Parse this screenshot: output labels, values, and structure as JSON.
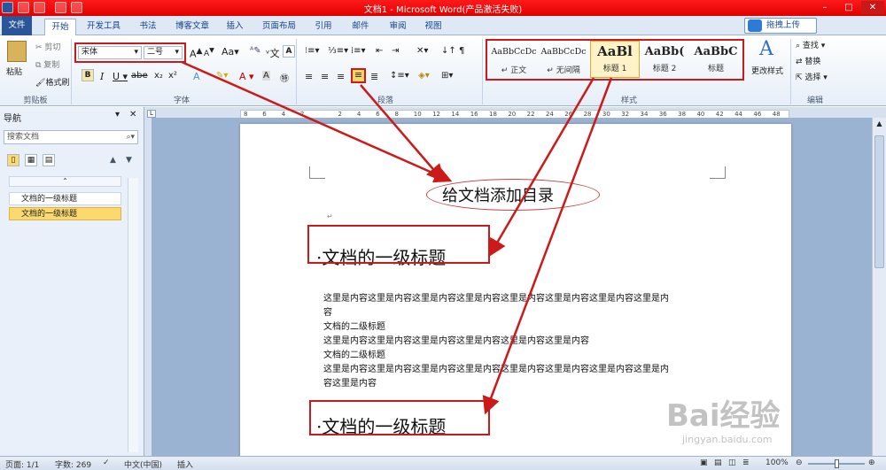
{
  "app": {
    "title": "文档1 - Microsoft Word(产品激活失败)"
  },
  "tabs": [
    {
      "label": "文件"
    },
    {
      "label": "开始"
    },
    {
      "label": "开发工具"
    },
    {
      "label": "书法"
    },
    {
      "label": "博客文章"
    },
    {
      "label": "插入"
    },
    {
      "label": "页面布局"
    },
    {
      "label": "引用"
    },
    {
      "label": "邮件"
    },
    {
      "label": "审阅"
    },
    {
      "label": "视图"
    }
  ],
  "share_button": "拖拽上传",
  "ribbon": {
    "clipboard": {
      "paste": "粘贴",
      "cut": "剪切",
      "copy": "复制",
      "format_painter": "格式刷",
      "group": "剪贴板"
    },
    "font": {
      "font_name": "宋体",
      "font_size": "二号",
      "group": "字体"
    },
    "paragraph": {
      "group": "段落"
    },
    "styles": {
      "items": [
        {
          "sample": "AaBbCcDc",
          "name": "↵ 正文"
        },
        {
          "sample": "AaBbCcDc",
          "name": "↵ 无间隔"
        },
        {
          "sample": "AaBl",
          "name": "标题 1"
        },
        {
          "sample": "AaBb(",
          "name": "标题 2"
        },
        {
          "sample": "AaBbC",
          "name": "标题"
        }
      ],
      "change_styles": "更改样式",
      "group": "样式"
    },
    "editing": {
      "find": "查找",
      "replace": "替换",
      "select": "选择",
      "group": "编辑"
    }
  },
  "nav": {
    "title": "导航",
    "search_placeholder": "搜索文档",
    "items": [
      {
        "label": "文档的一级标题"
      },
      {
        "label": "文档的一级标题"
      }
    ]
  },
  "ruler": {
    "ticks": [
      "8",
      "6",
      "4",
      "2",
      "",
      "2",
      "4",
      "6",
      "8",
      "10",
      "12",
      "14",
      "16",
      "18",
      "20",
      "22",
      "24",
      "26",
      "28",
      "30",
      "32",
      "34",
      "36",
      "38",
      "40",
      "42",
      "44",
      "46",
      "48"
    ]
  },
  "document": {
    "title": "给文档添加目录",
    "heading1": "·文档的一级标题",
    "para1_line1": "这里是内容这里是内容这里是内容这里是内容这里是内容这里是内容这里是内容这里是内",
    "para1_line2": "容",
    "sub1": "文档的二级标题",
    "para2": "这里是内容这里是内容这里是内容这里是内容这里是内容这里是内容",
    "sub2": "文档的二级标题",
    "para3_line1": "这里是内容这里是内容这里是内容这里是内容这里是内容这里是内容这里是内容这里是内",
    "para3_line2": "容这里是内容",
    "heading2": "·文档的一级标题"
  },
  "status": {
    "page": "页面: 1/1",
    "words": "字数: 269",
    "language": "中文(中国)",
    "mode": "插入",
    "zoom": "100%"
  },
  "watermark": {
    "logo": "Bai经验",
    "url": "jingyan.baidu.com"
  }
}
